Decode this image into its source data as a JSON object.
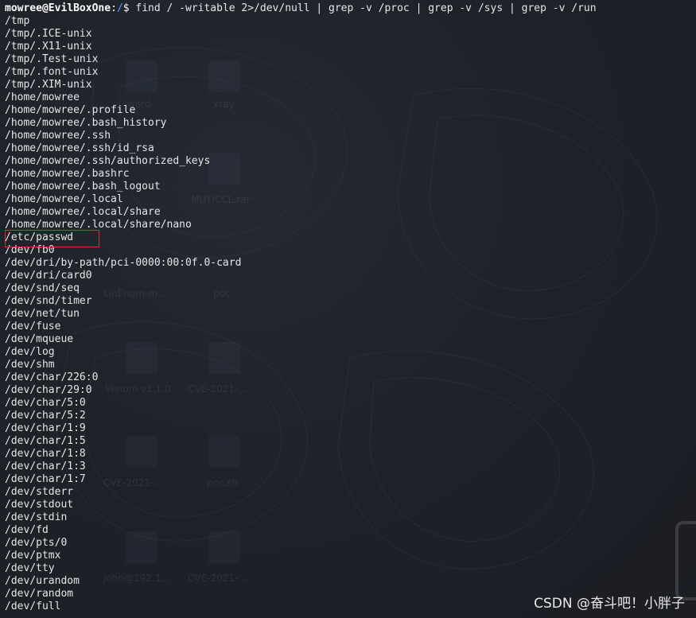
{
  "prompt": {
    "user_host": "mowree@EvilBoxOne",
    "separator": ":",
    "path": "/",
    "symbol": "$",
    "command": " find / -writable 2>/dev/null | grep -v /proc | grep -v /sys | grep -v /run"
  },
  "output_lines": [
    "/tmp",
    "/tmp/.ICE-unix",
    "/tmp/.X11-unix",
    "/tmp/.Test-unix",
    "/tmp/.font-unix",
    "/tmp/.XIM-unix",
    "/home/mowree",
    "/home/mowree/.profile",
    "/home/mowree/.bash_history",
    "/home/mowree/.ssh",
    "/home/mowree/.ssh/id_rsa",
    "/home/mowree/.ssh/authorized_keys",
    "/home/mowree/.bashrc",
    "/home/mowree/.bash_logout",
    "/home/mowree/.local",
    "/home/mowree/.local/share",
    "/home/mowree/.local/share/nano",
    "/etc/passwd",
    "/dev/fb0",
    "/dev/dri/by-path/pci-0000:00:0f.0-card",
    "/dev/dri/card0",
    "/dev/snd/seq",
    "/dev/snd/timer",
    "/dev/net/tun",
    "/dev/fuse",
    "/dev/mqueue",
    "/dev/log",
    "/dev/shm",
    "/dev/char/226:0",
    "/dev/char/29:0",
    "/dev/char/5:0",
    "/dev/char/5:2",
    "/dev/char/1:9",
    "/dev/char/1:5",
    "/dev/char/1:8",
    "/dev/char/1:3",
    "/dev/char/1:7",
    "/dev/stderr",
    "/dev/stdout",
    "/dev/stdin",
    "/dev/fd",
    "/dev/pts/0",
    "/dev/ptmx",
    "/dev/tty",
    "/dev/urandom",
    "/dev/random",
    "/dev/full"
  ],
  "highlighted_line": "/etc/passwd",
  "watermark": "CSDN @奋斗吧！小胖子",
  "desktop_ghost_labels": [
    "word",
    "xray",
    "MUTICCL.rar",
    "LinEnum-m...",
    "poc",
    "Venom v1.1.0",
    "CVE-2021-...",
    "CVE-2021-...",
    "poc.sh",
    "john@192.1...",
    "CVE-2021-..."
  ],
  "colors": {
    "background": "#1e2027",
    "text": "#e6e6e6",
    "prompt_path": "#5a8ef2",
    "highlight_border": "#d13438"
  }
}
